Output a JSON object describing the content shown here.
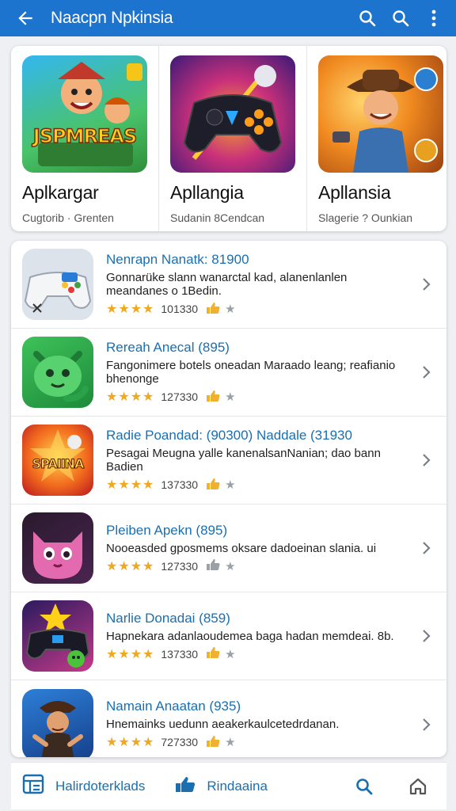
{
  "appbar": {
    "title": "Naacpn Npkinsia"
  },
  "featured": [
    {
      "name": "Aplkargar",
      "subtitle": "Cugtorib · Grenten",
      "art_text": "JSPMREAS"
    },
    {
      "name": "Apllangia",
      "subtitle": "Sudanin 8Cendcan",
      "art_text": ""
    },
    {
      "name": "Apllansia",
      "subtitle": "Slagerie ? Ounkian",
      "art_text": ""
    }
  ],
  "apps": [
    {
      "title": "Nenrapn Nanatk: 81900",
      "description": "Gonnarüke slann wanarctal kad, alanenlanlen meandanes o 1Bedin.",
      "rating_count": "101330",
      "thumb_text": ""
    },
    {
      "title": "Rereah Anecal (895)",
      "description": "Fangonimere botels oneadan Maraado leang; reafianio bhenonge",
      "rating_count": "127330",
      "thumb_text": ""
    },
    {
      "title": "Radie Poandad: (90300) Naddale (31930",
      "description": "Pesagai Meugna yalle kanenalsanNanian; dao bann Badien",
      "rating_count": "137330",
      "thumb_text": "SPAIINA"
    },
    {
      "title": "Pleiben Apekn (895)",
      "description": "Nooeasded gposmems oksare dadoeinan slania. ui",
      "rating_count": "127330",
      "thumb_text": ""
    },
    {
      "title": "Narlie Donadai (859)",
      "description": "Hapnekara adanlaoudemea baga hadan memdeai. 8b.",
      "rating_count": "137330",
      "thumb_text": ""
    },
    {
      "title": "Namain Anaatan (935)",
      "description": "Hnemainks uedunn aeakerkaulcetedrdanan.",
      "rating_count": "727330",
      "thumb_text": ""
    }
  ],
  "bottom_nav": {
    "left_label": "Halirdoterklads",
    "middle_label": "Rindaaina"
  },
  "colors": {
    "primary": "#1c74cf",
    "link": "#1a6fb0",
    "star": "#f0a820"
  },
  "icons": [
    "back-arrow-icon",
    "search-icon",
    "more-vert-icon",
    "chevron-right-icon",
    "thumb-up-icon",
    "menu-list-icon",
    "home-icon"
  ]
}
